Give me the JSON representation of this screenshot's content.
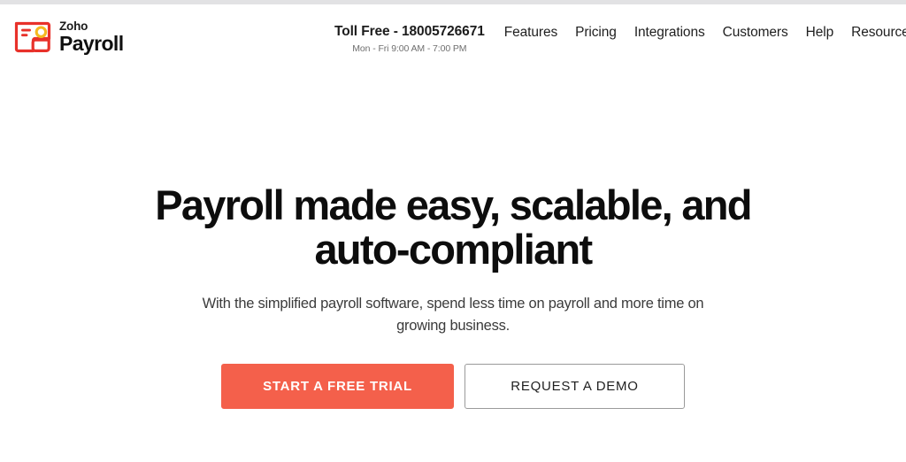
{
  "colors": {
    "accent": "#f4604b",
    "logo_red": "#e8312a",
    "logo_yellow": "#f5b820",
    "text_dark": "#0d0d0d",
    "text_muted": "#6f6f6f",
    "border_gray": "#9a9a9a",
    "top_strip": "#e2e2e4"
  },
  "header": {
    "logo": {
      "icon": "payroll-card-icon",
      "brand": "Zoho",
      "product": "Payroll"
    },
    "phone": {
      "label": "Toll Free - 18005726671",
      "hours": "Mon - Fri 9:00 AM - 7:00 PM"
    },
    "nav_items": [
      {
        "label": "Features",
        "has_dropdown": false
      },
      {
        "label": "Pricing",
        "has_dropdown": false
      },
      {
        "label": "Integrations",
        "has_dropdown": false
      },
      {
        "label": "Customers",
        "has_dropdown": false
      },
      {
        "label": "Help",
        "has_dropdown": false
      },
      {
        "label": "Resources",
        "has_dropdown": true,
        "caret_icon": "chevron-down-icon"
      }
    ]
  },
  "hero": {
    "title": "Payroll made easy, scalable, and auto-compliant",
    "subtitle": "With the simplified payroll software, spend less time on payroll and more time on growing business.",
    "primary_cta": "START A FREE TRIAL",
    "secondary_cta": "REQUEST A DEMO"
  }
}
